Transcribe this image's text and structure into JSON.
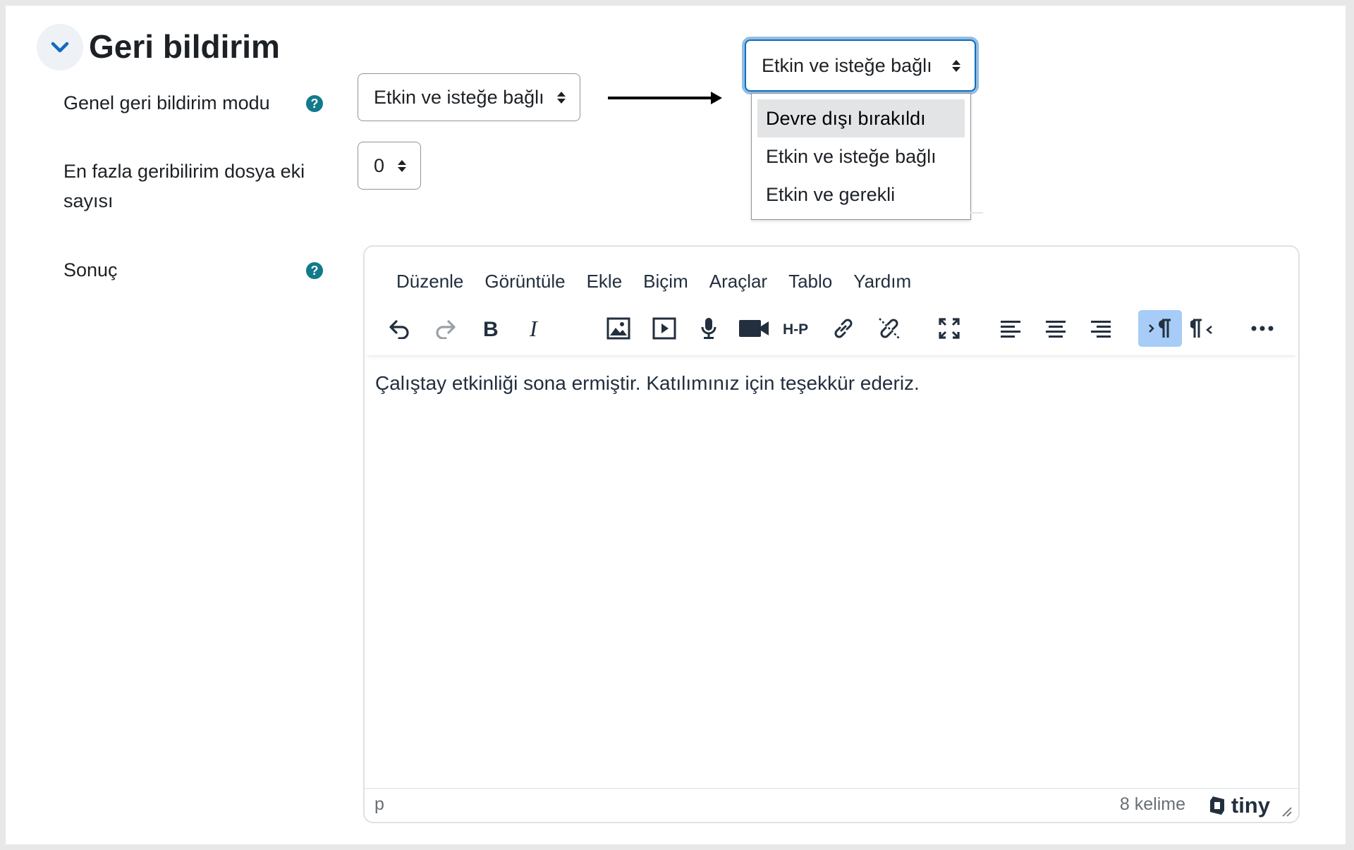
{
  "section": {
    "title": "Geri bildirim"
  },
  "fields": {
    "feedback_mode_label": "Genel geri bildirim modu",
    "feedback_mode_value": "Etkin ve isteğe bağlı",
    "max_attachments_label_line1": "En fazla geribilirim dosya eki",
    "max_attachments_label_line2": "sayısı",
    "max_attachments_value": "0",
    "conclusion_label": "Sonuç",
    "help_glyph": "?"
  },
  "dropdown_example": {
    "selected": "Etkin ve isteğe bağlı",
    "options": [
      "Devre dışı bırakıldı",
      "Etkin ve isteğe bağlı",
      "Etkin ve gerekli"
    ]
  },
  "editor": {
    "menu": [
      "Düzenle",
      "Görüntüle",
      "Ekle",
      "Biçim",
      "Araçlar",
      "Tablo",
      "Yardım"
    ],
    "toolbar_icons": [
      "undo-icon",
      "redo-icon",
      "bold-icon",
      "italic-icon",
      "image-icon",
      "media-icon",
      "microphone-icon",
      "video-camera-icon",
      "h5p-icon",
      "link-icon",
      "unlink-icon",
      "fullscreen-icon",
      "align-left-icon",
      "align-center-icon",
      "align-right-icon",
      "ltr-icon",
      "rtl-icon",
      "more-icon"
    ],
    "h5p_label": "H-P",
    "content": "Çalıştay etkinliği sona ermiştir. Katılımınız için teşekkür ederiz.",
    "status_path": "p",
    "word_count": "8 kelime",
    "brand": "tiny"
  },
  "colors": {
    "accent": "#0f6cbf",
    "help": "#117a8b",
    "active_button": "#a6ccf7"
  }
}
